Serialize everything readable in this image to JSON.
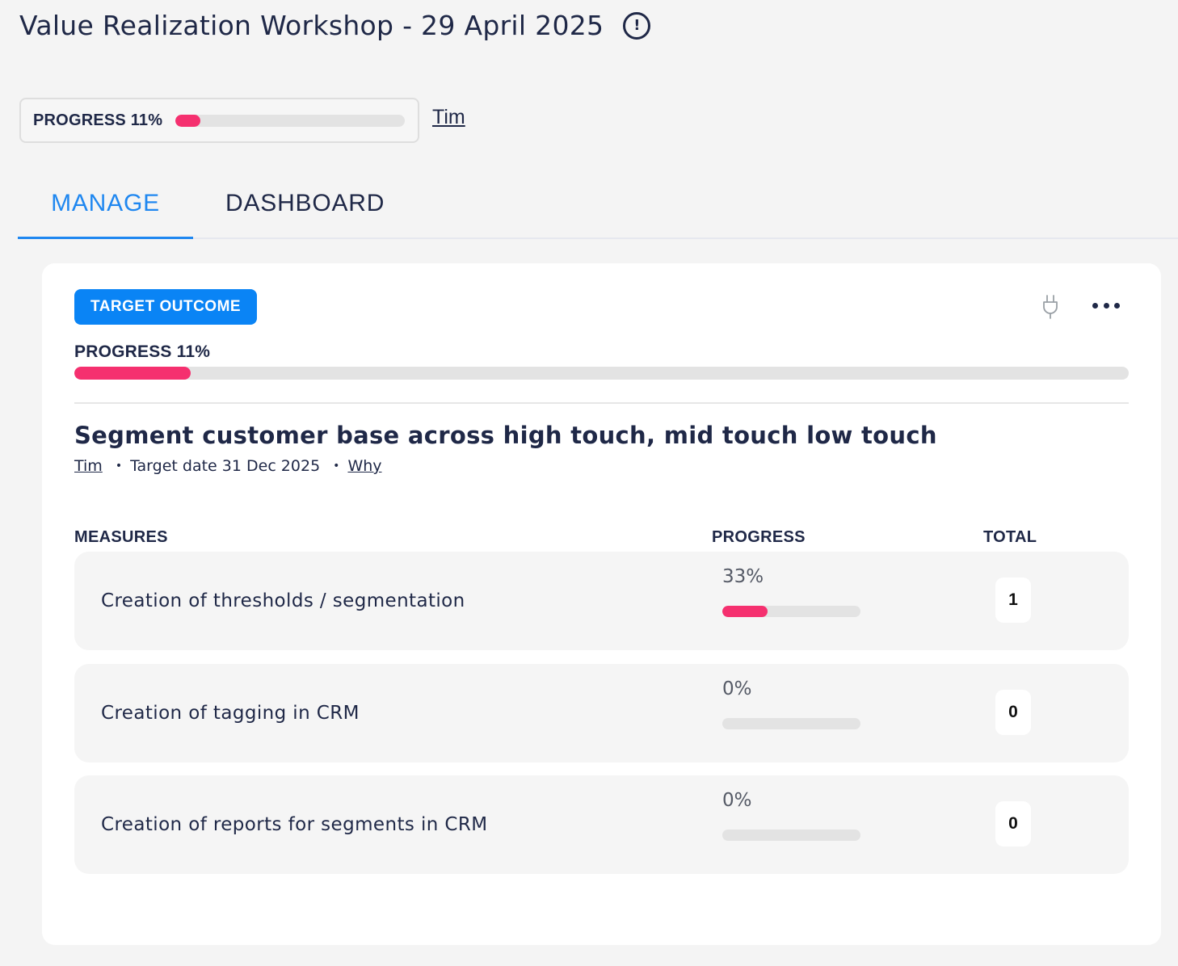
{
  "header": {
    "title": "Value Realization Workshop - 29 April 2025",
    "info_icon": "!",
    "progress_label": "PROGRESS 11%",
    "progress_value": 0.11,
    "owner": "Tim"
  },
  "tabs": [
    {
      "label": "MANAGE",
      "active": true
    },
    {
      "label": "DASHBOARD",
      "active": false
    }
  ],
  "card": {
    "badge": "TARGET OUTCOME",
    "icons": [
      "plug-icon",
      "more-icon"
    ],
    "progress_label": "PROGRESS 11%",
    "progress_value": 0.11,
    "title": "Segment customer base across high touch, mid touch low touch",
    "owner": "Tim",
    "target_date": "Target date 31 Dec 2025",
    "why_link": "Why",
    "columns": {
      "measures": "MEASURES",
      "progress": "PROGRESS",
      "total": "TOTAL"
    },
    "measures": [
      {
        "name": "Creation of thresholds / segmentation",
        "progress_label": "33%",
        "progress_value": 0.33,
        "total": "1"
      },
      {
        "name": "Creation of tagging in CRM",
        "progress_label": "0%",
        "progress_value": 0,
        "total": "0"
      },
      {
        "name": "Creation of reports for segments in CRM",
        "progress_label": "0%",
        "progress_value": 0,
        "total": "0"
      }
    ]
  },
  "colors": {
    "accent": "#0a84f5",
    "tab_active": "#1f87f0",
    "progress_fill": "#f5306f",
    "text": "#1f2847"
  }
}
